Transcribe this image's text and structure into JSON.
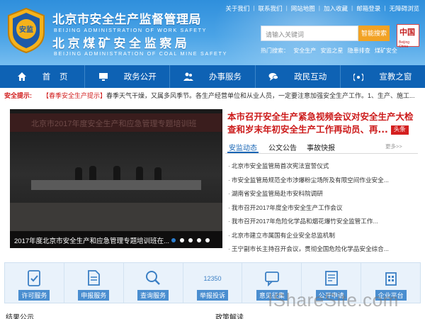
{
  "header": {
    "title_cn_1": "北京市安全生产监督管理局",
    "title_en_1": "BEIJING ADMINISTRATION OF WORK SAFETY",
    "title_cn_2": "北京煤矿安全监察局",
    "title_en_2": "BEIJING ADMINISTRATION OF COAL MINE SAFETY",
    "emblem_text": "安监",
    "top_links": [
      "关于我们",
      "联系我们",
      "网站地图",
      "加入收藏",
      "邮箱登录",
      "无障碍浏览"
    ],
    "search_placeholder": "请输入关键词",
    "search_button": "智能搜索",
    "hot_label": "热门搜索：",
    "hot_terms": [
      "安全生产",
      "安监之星",
      "隐患排查",
      "煤矿安全"
    ],
    "stamp_text": "中国",
    "stamp_sub": "Beijing China",
    "colors": {
      "header_blue": "#2f8fdc",
      "nav_blue": "#0e62b4",
      "accent_orange": "#f2a224",
      "headline_red": "#cc1a1a"
    }
  },
  "nav": {
    "items": [
      {
        "label": "首    页",
        "icon": "home-icon"
      },
      {
        "label": "政务公开",
        "icon": "monitor-icon"
      },
      {
        "label": "办事服务",
        "icon": "people-icon"
      },
      {
        "label": "政民互动",
        "icon": "chat-icon"
      },
      {
        "label": "宣教之窗",
        "icon": "broadcast-icon"
      }
    ]
  },
  "notice": {
    "label": "安全提示:",
    "tag": "【春季安全生产提示】",
    "text": "春季天气干燥，又属多风季节。各生产经营单位和从业人员，一定要注意加强安全生产工作。1、生产、施工..."
  },
  "slide": {
    "banner_text": "北京市2017年度安全生产和应急管理专题培训班",
    "caption": "2017年度北京市安全生产和应急管理专题培训班在...",
    "dots_total": 5,
    "active_dot": 1
  },
  "headline": {
    "text": "本市召开安全生产紧急视频会议对安全生产大检查和岁末年初安全生产工作再动员、再...",
    "badge": "头条"
  },
  "tabs": {
    "items": [
      "安监动态",
      "公文公告",
      "事故快报"
    ],
    "active": 0,
    "more": "更多>>"
  },
  "news": [
    "北京市安全监管局首次宪法宣誓仪式",
    "市安全监管局规范全市涉爆粉尘场所及有限空间作业安全...",
    "湖南省安全监管局赴市安科院调研",
    "我市召开2017年度全市安全生产工作会议",
    "我市召开2017年危险化学品和烟花爆竹安全监管工作...",
    "北京市建立市属国有企业安全总监机制",
    "王宁副市长主持召开会议，贯彻全国危险化学品安全综合..."
  ],
  "services": [
    {
      "label": "许可服务",
      "icon": "clipboard-check-icon"
    },
    {
      "label": "申报服务",
      "icon": "document-icon"
    },
    {
      "label": "查询服务",
      "icon": "magnifier-icon"
    },
    {
      "label": "举报投诉",
      "icon": "hotline-12350-icon",
      "icon_text": "12350"
    },
    {
      "label": "意见征集",
      "icon": "feedback-icon"
    },
    {
      "label": "公开申请",
      "icon": "form-icon"
    },
    {
      "label": "企业平台",
      "icon": "building-icon"
    }
  ],
  "bottom": {
    "left_heading": "结果公示",
    "right_heading": "政策解读"
  },
  "watermark": "IShareSite.com"
}
